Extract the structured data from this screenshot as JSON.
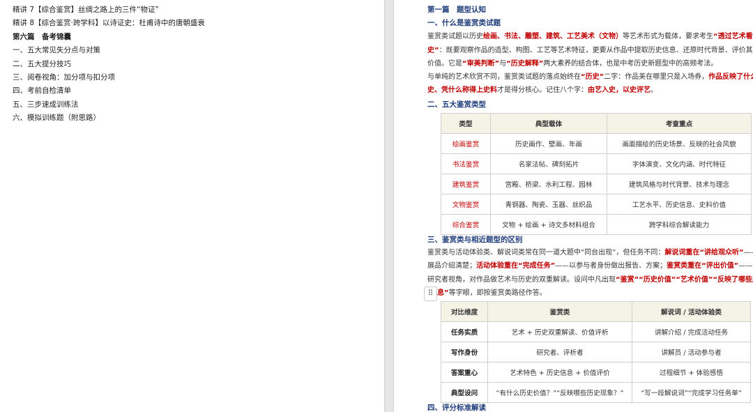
{
  "left_panel": {
    "items": [
      {
        "text": "精讲 7【综合鉴赏】丝绸之路上的三件“物证”",
        "bold": false
      },
      {
        "text": "精讲 8【综合鉴赏·跨学科】以诗证史：杜甫诗中的唐朝盛衰",
        "bold": false
      },
      {
        "text": "第六篇　备考锦囊",
        "bold": true
      },
      {
        "text": "一、五大常见失分点与对策",
        "bold": false
      },
      {
        "text": "二、五大提分技巧",
        "bold": false
      },
      {
        "text": "三、阅卷视角：加分项与扣分项",
        "bold": false
      },
      {
        "text": "四、考前自检清单",
        "bold": false
      },
      {
        "text": "五、三步速成训练法",
        "bold": false
      },
      {
        "text": "六、模拟训练题（附思路）",
        "bold": false
      }
    ]
  },
  "document": {
    "part_title": "第一篇　题型认知",
    "section1": {
      "heading": "一、什么是鉴赏类试题",
      "p1_a": "鉴赏类试题以历史",
      "p1_b": "绘画、书法、雕塑、建筑、工艺美术（文物）",
      "p1_c": "等艺术形式为载体，要求考生",
      "p1_d": "“透过艺术看历",
      "p1_e": "史”",
      "p1_f": "：既要观察作品的造型、构图、工艺等艺术特征，更要从作品中提取历史信息、还原时代背景、评价其历",
      "p1_g": "价值。它是",
      "p1_h": "“审美判断”",
      "p1_i": "与",
      "p1_j": "“历史解释”",
      "p1_k": "两大素养的结合体，也是中考历史新题型中的高频考法。",
      "p2_a": "与单纯的艺术欣赏不同，鉴赏类试题的落点始终在",
      "p2_b": "“历史”",
      "p2_c": "二字：作品美在哪里只是入场券，",
      "p2_d": "作品反映了什么",
      "p2_e": "史、凭什么称得上史料",
      "p2_f": "才是得分核心。记住八个字：",
      "p2_g": "由艺入史，以史评艺",
      "p2_h": "。"
    },
    "section2": {
      "heading": "二、五大鉴赏类型",
      "headers": [
        "类型",
        "典型载体",
        "考查重点"
      ],
      "rows": [
        [
          "绘画鉴赏",
          "历史画作、壁画、年画",
          "画面描绘的历史场景、反映的社会风貌"
        ],
        [
          "书法鉴赏",
          "名家法帖、碑刻拓片",
          "字体演变、文化内涵、时代特征"
        ],
        [
          "建筑鉴赏",
          "宫殿、桥梁、水利工程、园林",
          "建筑风格与时代背景、技术与理念"
        ],
        [
          "文物鉴赏",
          "青铜器、陶瓷、玉器、丝织品",
          "工艺水平、历史信息、史料价值"
        ],
        [
          "综合鉴赏",
          "文物 + 绘画 + 诗文多材料组合",
          "跨学科综合解读能力"
        ]
      ]
    },
    "section3": {
      "heading": "三、鉴赏类与相近题型的区别",
      "l1_a": "鉴赏类与活动体验类、解说词类常在同一道大题中“同台出现”，但任务不同：",
      "l1_b": "解说词重在“讲给观众听”",
      "l1_c": "——",
      "l2_a": "展品介绍清楚；",
      "l2_b": "活动体验重在“完成任务”",
      "l2_c": "——以参与者身份做出报告、方案；",
      "l2_d": "鉴赏类重在“评出价值”",
      "l2_e": "——站",
      "l3_a": "研究者视角，对作品做艺术与历史的双重解读。设问中凡出现",
      "l3_b": "“鉴赏”“历史价值”“艺术价值”“反映了哪些历史",
      "l4_a": "息”",
      "l4_b": "等字眼，即按鉴赏类路径作答。",
      "headers": [
        "对比维度",
        "鉴赏类",
        "解说词 / 活动体验类"
      ],
      "rows": [
        [
          "任务实质",
          "艺术 + 历史双重解读、价值评析",
          "讲解介绍 / 完成活动任务"
        ],
        [
          "写作身份",
          "研究者、评析者",
          "讲解员 / 活动参与者"
        ],
        [
          "答案重心",
          "艺术特色 + 历史信息 + 价值评价",
          "过程细节 + 体验感悟"
        ],
        [
          "典型设问",
          "“有什么历史价值？”“反映哪些历史现象？”",
          "“写一段解说词”“完成学习任务单”"
        ]
      ]
    },
    "section4": {
      "heading": "四、评分标准解读"
    },
    "drag_handle_icon": "drag-handle-icon"
  }
}
